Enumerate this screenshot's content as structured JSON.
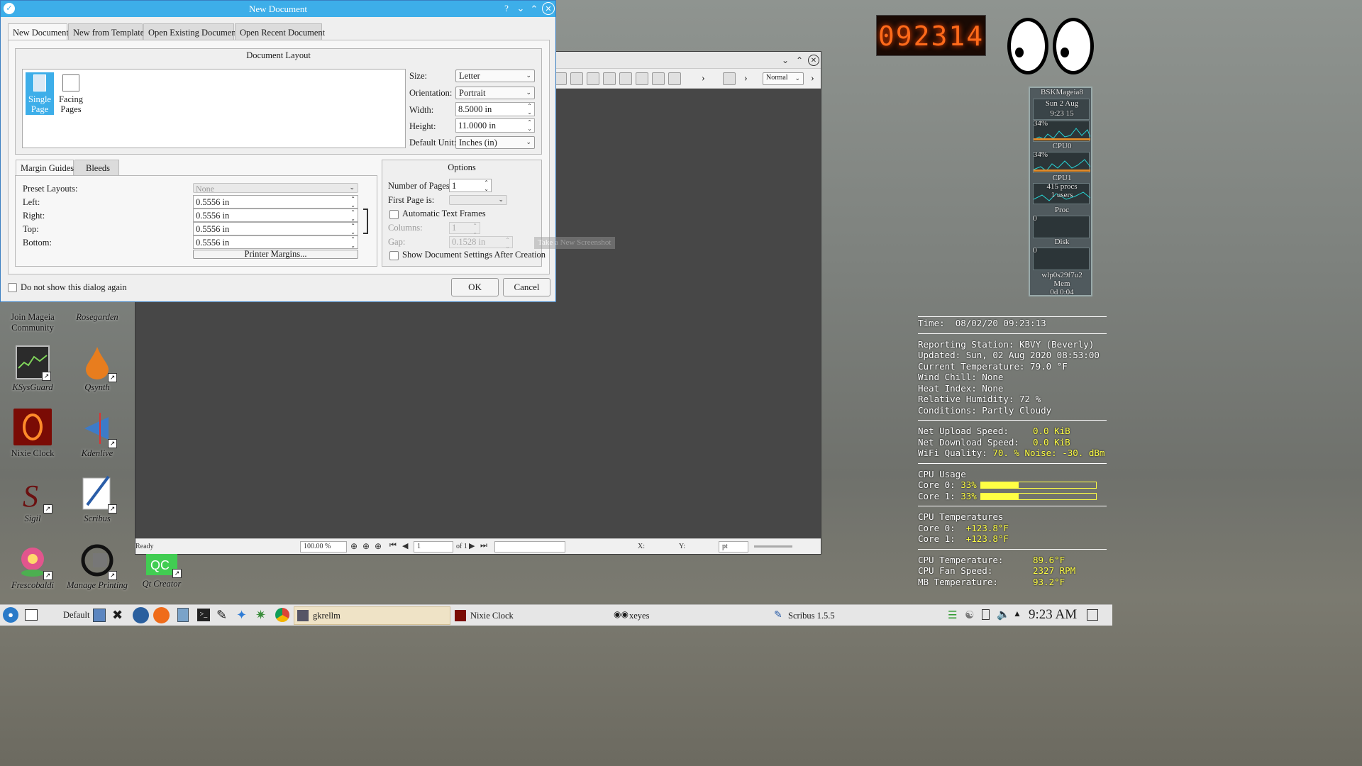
{
  "dialog": {
    "title": "New Document",
    "tabs": [
      "New Document",
      "New from Template",
      "Open Existing Document",
      "Open Recent Document"
    ],
    "layout": {
      "title": "Document Layout",
      "pages": [
        {
          "label": "Single Page"
        },
        {
          "label": "Facing Pages"
        }
      ],
      "size_label": "Size:",
      "size_value": "Letter",
      "orientation_label": "Orientation:",
      "orientation_value": "Portrait",
      "width_label": "Width:",
      "width_value": "8.5000 in",
      "height_label": "Height:",
      "height_value": "11.0000 in",
      "unit_label": "Default Unit:",
      "unit_value": "Inches (in)"
    },
    "margins": {
      "tabs": [
        "Margin Guides",
        "Bleeds"
      ],
      "preset_label": "Preset Layouts:",
      "preset_value": "None",
      "left_label": "Left:",
      "left_value": "0.5556 in",
      "right_label": "Right:",
      "right_value": "0.5556 in",
      "top_label": "Top:",
      "top_value": "0.5556 in",
      "bottom_label": "Bottom:",
      "bottom_value": "0.5556 in",
      "printer_button": "Printer Margins..."
    },
    "options": {
      "title": "Options",
      "pages_label": "Number of Pages:",
      "pages_value": "1",
      "first_page_label": "First Page is:",
      "auto_frames_label": "Automatic Text Frames",
      "columns_label": "Columns:",
      "columns_value": "1",
      "gap_label": "Gap:",
      "gap_value": "0.1528 in",
      "show_settings_label": "Show Document Settings After Creation",
      "tooltip": "Take a New Screenshot"
    },
    "do_not_show_label": "Do not show this dialog again",
    "ok_button": "OK",
    "cancel_button": "Cancel"
  },
  "scribus": {
    "zoom_mode": "Normal",
    "status": "Ready",
    "zoom_value": "100.00 %",
    "page_value": "1",
    "page_of": "of 1",
    "x_label": "X:",
    "y_label": "Y:",
    "unit": "pt"
  },
  "desktop_icons": [
    {
      "label": "Join Mageia Community"
    },
    {
      "label": "Rosegarden"
    },
    {
      "label": "KSysGuard"
    },
    {
      "label": "Qsynth"
    },
    {
      "label": "Nixie Clock"
    },
    {
      "label": "Kdenlive"
    },
    {
      "label": "Sigil"
    },
    {
      "label": "Scribus"
    },
    {
      "label": "Frescobaldi"
    },
    {
      "label": "Manage Printing"
    },
    {
      "label": "Qt Creator"
    }
  ],
  "nixie": "092314",
  "gkrellm": {
    "hostname": "BSKMageia8",
    "date": "Sun 2 Aug",
    "time": "9:23 15",
    "cpu_pct_1": "34%",
    "cpu0": "CPU0",
    "cpu_pct_2": "34%",
    "cpu1": "CPU1",
    "procs": "415 procs",
    "users": "1 users",
    "proc": "Proc",
    "proc_val": "0",
    "disk": "Disk",
    "disk_val": "0",
    "iface": "wlp0s29f7u2",
    "mem": "Mem",
    "uptime": "0d 0:04"
  },
  "conky": {
    "time_label": "Time:",
    "time_value": "08/02/20 09:23:13",
    "station": "Reporting Station: KBVY (Beverly)",
    "updated": "Updated: Sun, 02 Aug 2020 08:53:00",
    "temp": "Current Temperature: 79.0 °F",
    "windchill": "Wind Chill: None",
    "heat": "Heat Index: None",
    "humidity": "Relative Humidity: 72 %",
    "conditions": "Conditions: Partly Cloudy",
    "up_label": "Net Upload Speed:",
    "up_value": "0.0 KiB",
    "down_label": "Net Download Speed:",
    "down_value": "0.0 KiB",
    "wifi_label": "WiFi Quality:",
    "wifi_value": "70. % Noise: -30. dBm",
    "cpu_usage": "CPU Usage",
    "core0_label": "Core 0:",
    "core0_value": "33%",
    "core0_fraction": 0.33,
    "core1_label": "Core 1:",
    "core1_value": "33%",
    "core1_fraction": 0.33,
    "cpu_temps": "CPU Temperatures",
    "t0_label": "Core 0:",
    "t0_value": "+123.8°F",
    "t1_label": "Core 1:",
    "t1_value": "+123.8°F",
    "cputemp_label": "CPU Temperature:",
    "cputemp_value": "89.6°F",
    "fan_label": "CPU Fan Speed:",
    "fan_value": "2327 RPM",
    "mb_label": "MB Temperature:",
    "mb_value": "93.2°F"
  },
  "taskbar": {
    "activity": "Default",
    "tasks": [
      "gkrellm",
      "Nixie Clock",
      "xeyes",
      "Scribus 1.5.5"
    ],
    "clock": "9:23 AM"
  },
  "colors": {
    "accent": "#3daee9",
    "conky_yellow": "#ffff44",
    "nixie": "#ff6a1a"
  }
}
